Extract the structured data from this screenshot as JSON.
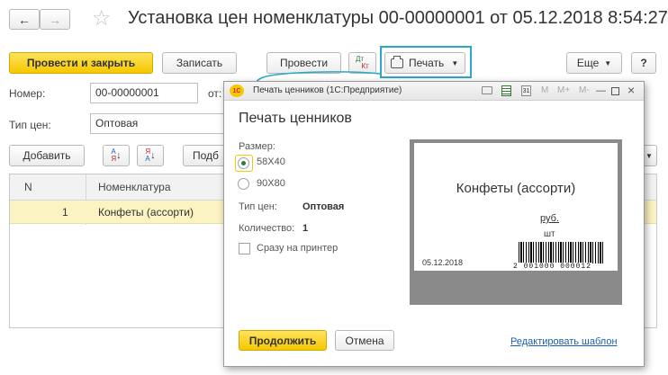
{
  "window": {
    "title": "Установка цен номенклатуры 00-00000001 от 05.12.2018 8:54:27"
  },
  "toolbar": {
    "post_close": "Провести и закрыть",
    "write": "Записать",
    "post": "Провести",
    "dt_kt_top": "Дт",
    "dt_kt_bottom": "Кт",
    "print": "Печать",
    "more": "Еще",
    "help": "?"
  },
  "form": {
    "number_label": "Номер:",
    "number_value": "00-00000001",
    "date_label": "от:",
    "price_type_label": "Тип цен:",
    "price_type_value": "Оптовая"
  },
  "table_toolbar": {
    "add": "Добавить",
    "sort_asc_top": "А",
    "sort_asc_bottom": "Я",
    "sort_desc_top": "Я",
    "sort_desc_bottom": "А",
    "pick": "Подб"
  },
  "table": {
    "columns": [
      "N",
      "Номенклатура"
    ],
    "rows": [
      {
        "n": "1",
        "name": "Конфеты (ассорти)"
      }
    ]
  },
  "dialog": {
    "window_title": "Печать ценников (1С:Предприятие)",
    "app_logo": "1С",
    "titlebar_icons": [
      "M",
      "M+",
      "M-"
    ],
    "heading": "Печать ценников",
    "size_label": "Размер:",
    "size_options": [
      "58X40",
      "90X80"
    ],
    "size_selected": "58X40",
    "price_type_label": "Тип цен:",
    "price_type_value": "Оптовая",
    "quantity_label": "Количество:",
    "quantity_value": "1",
    "direct_print_label": "Сразу на принтер",
    "direct_print_checked": false,
    "continue": "Продолжить",
    "cancel": "Отмена",
    "edit_template": "Редактировать шаблон"
  },
  "preview": {
    "product": "Конфеты (ассорти)",
    "currency": "руб.",
    "unit": "шт",
    "date": "05.12.2018",
    "barcode_text": "2 001000 000012"
  },
  "colors": {
    "primary_button": "#f5c800",
    "highlight_row": "#fbf3c1",
    "callout": "#2aa8c8",
    "link": "#1a5fb4"
  }
}
